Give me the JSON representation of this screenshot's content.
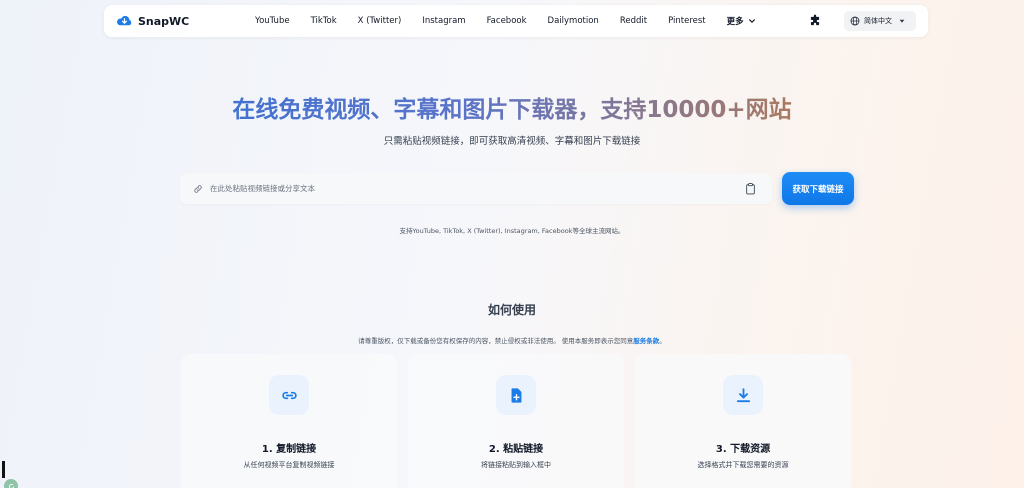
{
  "brand": {
    "name": "SnapWC",
    "color": "#1d7de8"
  },
  "nav": {
    "links": [
      "YouTube",
      "TikTok",
      "X (Twitter)",
      "Instagram",
      "Facebook",
      "Dailymotion",
      "Reddit",
      "Pinterest"
    ],
    "more_label": "更多",
    "language_label": "简体中文"
  },
  "hero": {
    "title": "在线免费视频、字幕和图片下载器，支持10000+网站",
    "subtitle": "只需粘贴视频链接，即可获取高清视频、字幕和图片下载链接",
    "search_placeholder": "在此处粘贴视频链接或分享文本",
    "submit_label": "获取下载链接",
    "supported_text": "支持YouTube, TikTok, X (Twitter), Instagram, Facebook等全球主流网站。"
  },
  "howto": {
    "title": "如何使用",
    "notice_prefix": "请尊重版权，仅下载或备份您有权保存的内容，禁止侵权或非法使用。 使用本服务即表示您同意",
    "notice_link": "服务条款",
    "notice_suffix": "。",
    "steps": [
      {
        "title": "1. 复制链接",
        "desc": "从任何视频平台复制视频链接",
        "icon": "link-icon"
      },
      {
        "title": "2. 粘贴链接",
        "desc": "将链接粘贴到输入框中",
        "icon": "file-plus-icon"
      },
      {
        "title": "3. 下载资源",
        "desc": "选择格式并下载您需要的资源",
        "icon": "download-icon"
      }
    ]
  },
  "colors": {
    "accent": "#1d7de8",
    "title_gradient_start": "#2b6fd6",
    "title_gradient_end": "#c06a38"
  }
}
